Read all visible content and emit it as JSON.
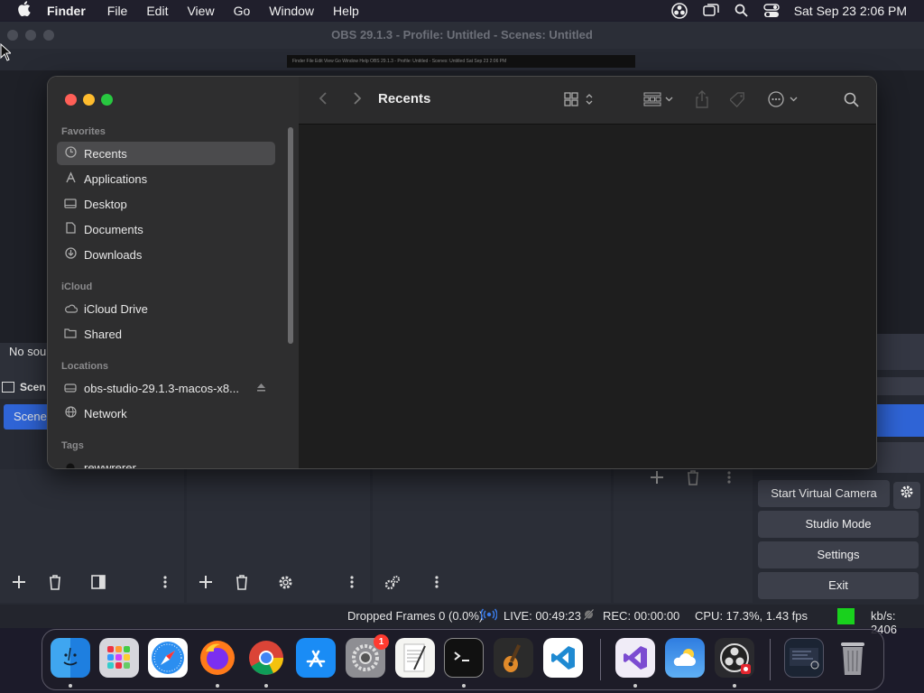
{
  "menubar": {
    "app_name": "Finder",
    "items": [
      "File",
      "Edit",
      "View",
      "Go",
      "Window",
      "Help"
    ],
    "clock": "Sat Sep 23  2:06 PM"
  },
  "obs": {
    "title": "OBS 29.1.3 - Profile: Untitled - Scenes: Untitled",
    "preview_menubar": "Finder  File  Edit  View  Go  Window  Help        OBS 29.1.3 - Profile: Untitled - Scenes: Untitled                Sat Sep 23 2:06 PM",
    "no_source_text": "No sou",
    "scenes_header": "Scen",
    "scene_item": "Scene",
    "controls": {
      "virtual_camera": "Start Virtual Camera",
      "studio_mode": "Studio Mode",
      "settings": "Settings",
      "exit": "Exit"
    },
    "status": {
      "dropped": "Dropped Frames 0 (0.0%)",
      "live": "LIVE: 00:49:23",
      "rec": "REC: 00:00:00",
      "cpu": "CPU: 17.3%, 1.43 fps",
      "kbs": "kb/s: 2406",
      "indicator_color": "#19d11d"
    }
  },
  "finder": {
    "title": "Recents",
    "sections": {
      "favorites": "Favorites",
      "icloud": "iCloud",
      "locations": "Locations",
      "tags": "Tags"
    },
    "favorites": [
      "Recents",
      "Applications",
      "Desktop",
      "Documents",
      "Downloads"
    ],
    "icloud": [
      "iCloud Drive",
      "Shared"
    ],
    "locations": [
      "obs-studio-29.1.3-macos-x8...",
      "Network"
    ],
    "tags": [
      "rewwrerer"
    ]
  },
  "dock": {
    "apps": [
      "Finder",
      "Launchpad",
      "Safari",
      "Firefox",
      "Chrome",
      "App Store",
      "System Settings",
      "TextEdit",
      "Terminal",
      "GarageBand",
      "VS Code",
      "Visual Studio",
      "Weather",
      "OBS",
      "Screenshot",
      "Trash"
    ],
    "settings_badge": "1"
  }
}
